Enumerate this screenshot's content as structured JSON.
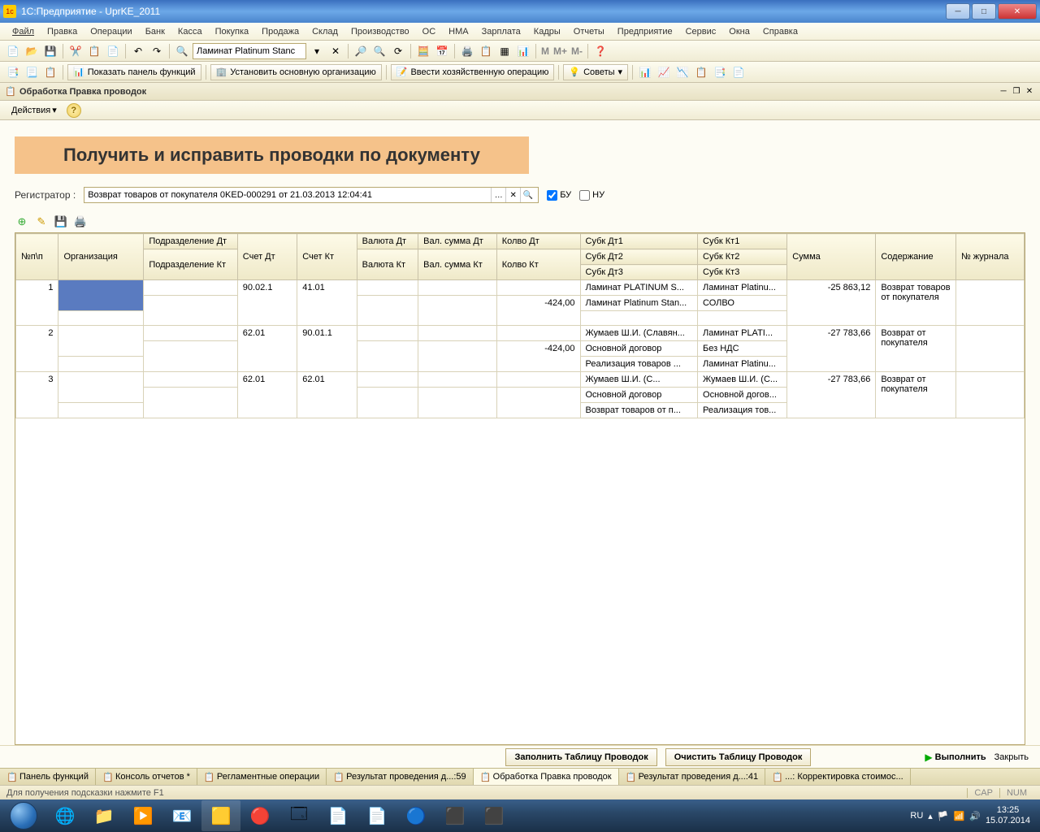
{
  "window": {
    "title": "1С:Предприятие - UprKE_2011"
  },
  "menu": [
    "Файл",
    "Правка",
    "Операции",
    "Банк",
    "Касса",
    "Покупка",
    "Продажа",
    "Склад",
    "Производство",
    "ОС",
    "НМА",
    "Зарплата",
    "Кадры",
    "Отчеты",
    "Предприятие",
    "Сервис",
    "Окна",
    "Справка"
  ],
  "toolbar1": {
    "search_value": "Ламинат Platinum Stanс",
    "m": "M",
    "mplus": "M+",
    "mminus": "M-"
  },
  "toolbar2": {
    "b1": "Показать панель функций",
    "b2": "Установить основную организацию",
    "b3": "Ввести хозяйственную операцию",
    "b4": "Советы"
  },
  "subwin": {
    "title": "Обработка  Правка проводок"
  },
  "actionbar": {
    "actions": "Действия"
  },
  "main": {
    "heading": "Получить и исправить проводки по документу",
    "reg_label": "Регистратор :",
    "reg_value": "Возврат товаров от покупателя 0KED-000291 от 21.03.2013 12:04:41",
    "chk_bu": "БУ",
    "chk_nu": "НУ"
  },
  "columns": {
    "c1": "№п\\п",
    "c2": "Организация",
    "c3a": "Подразделение Дт",
    "c3b": "Подразделение Кт",
    "c4": "Счет Дт",
    "c5": "Счет Кт",
    "c6a": "Валюта Дт",
    "c6b": "Валюта Кт",
    "c7a": "Вал. сумма Дт",
    "c7b": "Вал. сумма Кт",
    "c8a": "Колво Дт",
    "c8b": "Колво Кт",
    "c9a": "Субк Дт1",
    "c9b": "Субк Дт2",
    "c9c": "Субк Дт3",
    "c10a": "Субк Кт1",
    "c10b": "Субк Кт2",
    "c10c": "Субк Кт3",
    "c11": "Сумма",
    "c12": "Содержание",
    "c13": "№ журнала"
  },
  "rows": [
    {
      "n": "1",
      "schet_dt": "90.02.1",
      "schet_kt": "41.01",
      "kolvo_kt": "-424,00",
      "sd1": "Ламинат PLATINUM S...",
      "sd2": "Ламинат Platinum Stan...",
      "sd3": "",
      "sk1": "Ламинат Platinu...",
      "sk2": "СОЛВО",
      "sk3": "",
      "sum": "-25 863,12",
      "desc": "Возврат товаров от покупателя"
    },
    {
      "n": "2",
      "schet_dt": "62.01",
      "schet_kt": "90.01.1",
      "kolvo_kt": "-424,00",
      "sd1": "Жумаев Ш.И. (Славян...",
      "sd2": "Основной договор",
      "sd3": "Реализация товаров ...",
      "sk1": "Ламинат PLATI...",
      "sk2": "Без НДС",
      "sk3": "Ламинат Platinu...",
      "sum": "-27 783,66",
      "desc": "Возврат от покупателя"
    },
    {
      "n": "3",
      "schet_dt": "62.01",
      "schet_kt": "62.01",
      "kolvo_kt": "",
      "sd1": "Жумаев Ш.И. (С...",
      "sd2": "Основной договор",
      "sd3": "Возврат товаров от п...",
      "sk1": "Жумаев Ш.И. (С...",
      "sk2": "Основной догов...",
      "sk3": "Реализация тов...",
      "sum": "-27 783,66",
      "desc": "Возврат от покупателя"
    }
  ],
  "buttons": {
    "fill": "Заполнить Таблицу Проводок",
    "clear": "Очистить Таблицу Проводок",
    "run": "Выполнить",
    "close": "Закрыть"
  },
  "doctabs": [
    {
      "t": "Панель функций"
    },
    {
      "t": "Консоль отчетов *"
    },
    {
      "t": "Регламентные операции"
    },
    {
      "t": "Результат проведения д...:59"
    },
    {
      "t": "Обработка  Правка проводок",
      "active": true
    },
    {
      "t": "Результат проведения д...:41"
    },
    {
      "t": "...: Корректировка стоимос..."
    }
  ],
  "status": {
    "hint": "Для получения подсказки нажмите F1",
    "cap": "CAP",
    "num": "NUM"
  },
  "tray": {
    "lang": "RU",
    "time": "13:25",
    "date": "15.07.2014"
  }
}
